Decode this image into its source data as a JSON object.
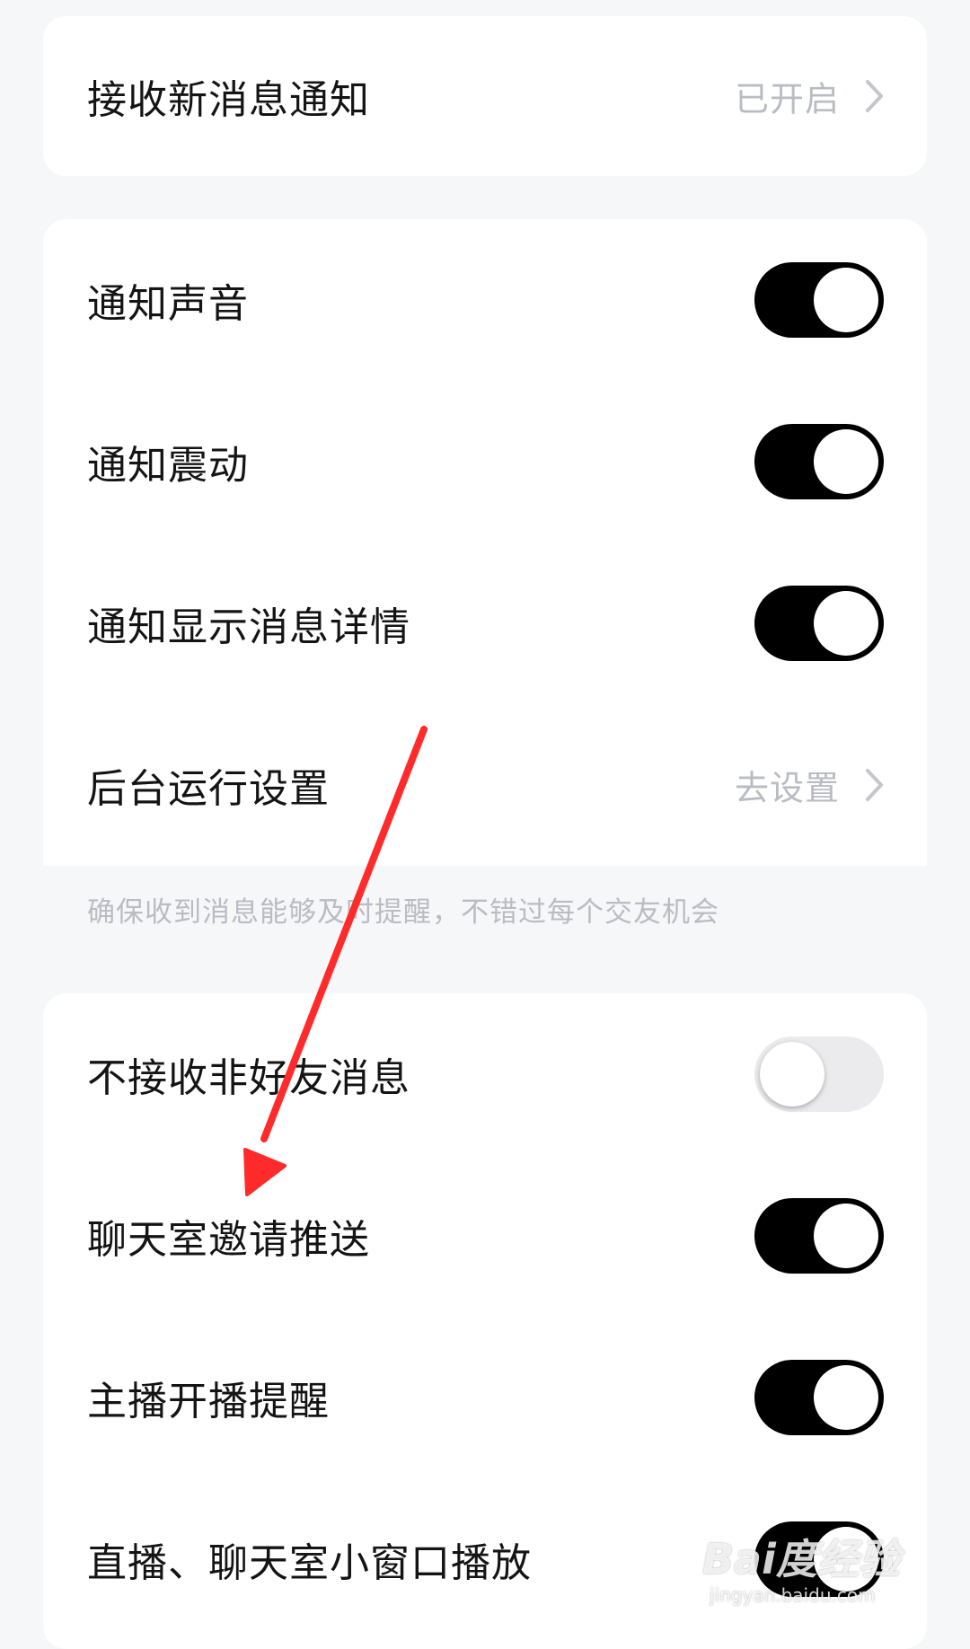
{
  "section1": {
    "new_message_notification": {
      "label": "接收新消息通知",
      "value": "已开启"
    }
  },
  "section2": {
    "items": [
      {
        "label": "通知声音",
        "on": true
      },
      {
        "label": "通知震动",
        "on": true
      },
      {
        "label": "通知显示消息详情",
        "on": true
      }
    ],
    "background_run": {
      "label": "后台运行设置",
      "value": "去设置"
    },
    "note": "确保收到消息能够及时提醒，不错过每个交友机会"
  },
  "section3": {
    "items": [
      {
        "label": "不接收非好友消息",
        "on": false
      },
      {
        "label": "聊天室邀请推送",
        "on": true
      },
      {
        "label": "主播开播提醒",
        "on": true
      },
      {
        "label": "直播、聊天室小窗口播放",
        "on": true
      }
    ]
  },
  "watermark": {
    "logo": "Bai度经验",
    "url": "jingyan.baidu.com"
  },
  "colors": {
    "page_background": "#f6f7f9",
    "card_background": "#ffffff",
    "toggle_on": "#000000",
    "toggle_off": "#ebebed",
    "secondary_text": "#b9bcc2",
    "annotation_arrow": "#ff2a2a"
  }
}
